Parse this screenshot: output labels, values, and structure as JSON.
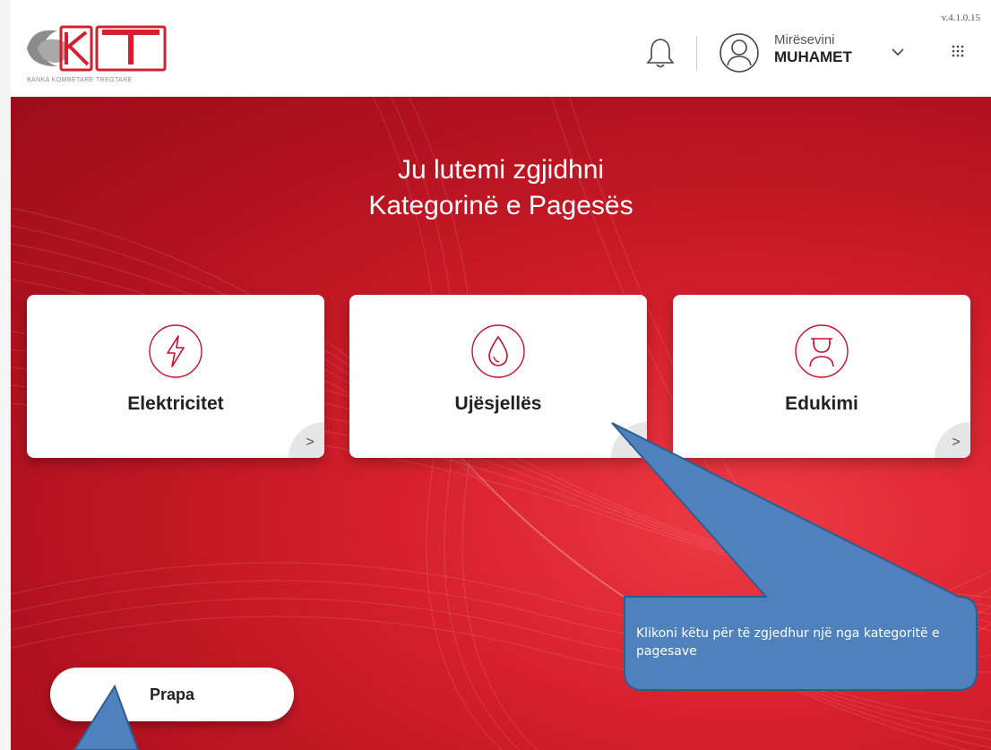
{
  "header": {
    "logo_text": "BKT",
    "logo_subtitle": "BANKA KOMBËTARE TREGTARE",
    "version": "v.4.1.0.15",
    "greeting": "Mirësevini",
    "user_name": "MUHAMET"
  },
  "main": {
    "title_line1": "Ju lutemi zgjidhni",
    "title_line2": "Kategorinë e Pagesës",
    "categories": [
      {
        "label": "Elektricitet",
        "icon": "lightning-icon"
      },
      {
        "label": "Ujësjellës",
        "icon": "water-drop-icon"
      },
      {
        "label": "Edukimi",
        "icon": "graduate-icon"
      }
    ],
    "arrow_glyph": ">",
    "back_label": "Prapa"
  },
  "callout": {
    "text": "Klikoni këtu për të zgjedhur një nga kategoritë e pagesave",
    "fill": "#4f81bd",
    "stroke": "#2f5d91"
  },
  "colors": {
    "brand_red": "#d51f2c",
    "icon_red": "#c8102e"
  }
}
